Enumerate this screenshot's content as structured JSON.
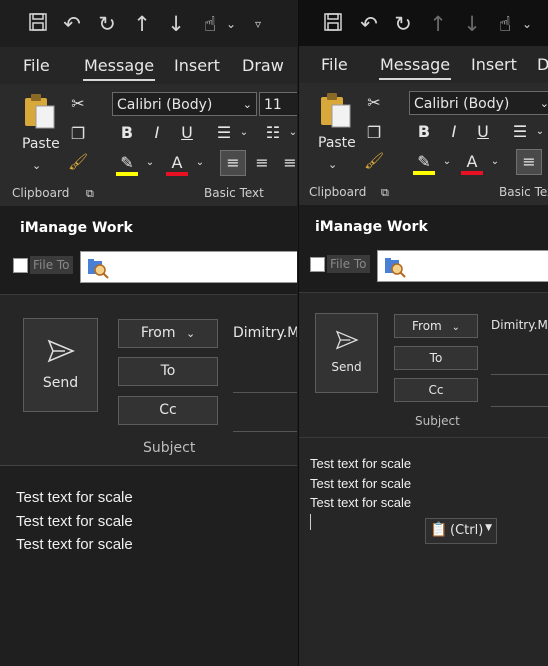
{
  "left": {
    "tabs": [
      "File",
      "Message",
      "Insert",
      "Draw"
    ],
    "font_name": "Calibri (Body)",
    "font_size": "11",
    "paste_label": "Paste",
    "clipboard_label": "Clipboard",
    "basic_text_label": "Basic Text",
    "imanage_title": "iManage Work",
    "file_to_label": "File To",
    "send_label": "Send",
    "from_label": "From",
    "to_label": "To",
    "cc_label": "Cc",
    "from_value": "Dimitry.M",
    "subject_label": "Subject",
    "body_lines": [
      "Test text for scale",
      "Test text for scale",
      "Test text for scale"
    ]
  },
  "right": {
    "tabs": [
      "File",
      "Message",
      "Insert",
      "D"
    ],
    "font_name": "Calibri (Body)",
    "paste_label": "Paste",
    "clipboard_label": "Clipboard",
    "basic_text_label": "Basic Tex",
    "imanage_title": "iManage Work",
    "file_to_label": "File To",
    "send_label": "Send",
    "from_label": "From",
    "to_label": "To",
    "cc_label": "Cc",
    "from_value": "Dimitry.Ma",
    "subject_label": "Subject",
    "body_lines": [
      "Test text for scale",
      "Test text for scale",
      "Test text for scale"
    ],
    "paste_options_label": "(Ctrl)"
  },
  "colors": {
    "highlight": "#ffff00",
    "font_color": "#e81123",
    "clip_gold": "#d8a93a"
  }
}
